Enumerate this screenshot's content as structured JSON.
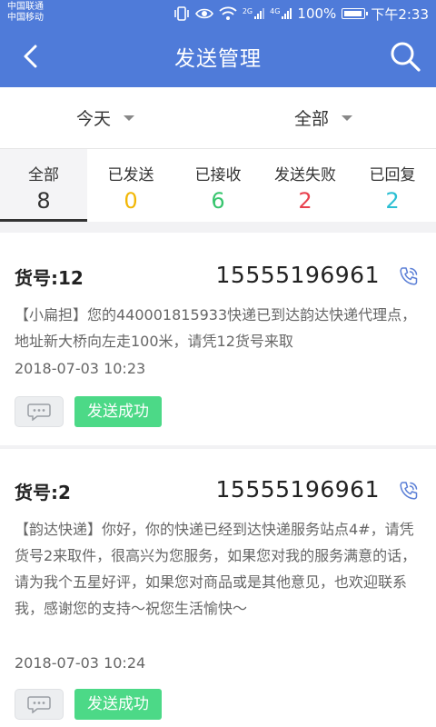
{
  "status_bar": {
    "carrier1": "中国联通",
    "carrier2": "中国移动",
    "net_label_1": "2G",
    "net_label_2": "4G",
    "battery": "100%",
    "battery_level": 1.0,
    "time": "下午2:33"
  },
  "header": {
    "title": "发送管理",
    "back_icon": "chevron-left-icon",
    "search_icon": "search-icon",
    "bg_color": "#4f7bd9"
  },
  "filters": {
    "date": "今天",
    "status": "全部"
  },
  "tabs": [
    {
      "label": "全部",
      "count": "8",
      "color": "#333333",
      "active": true
    },
    {
      "label": "已发送",
      "count": "0",
      "color": "#f2b705",
      "active": false
    },
    {
      "label": "已接收",
      "count": "6",
      "color": "#37c56e",
      "active": false
    },
    {
      "label": "发送失败",
      "count": "2",
      "color": "#e8414e",
      "active": false
    },
    {
      "label": "已回复",
      "count": "2",
      "color": "#2bbfd3",
      "active": false
    }
  ],
  "messages": [
    {
      "goods_no": "货号:12",
      "phone": "15555196961",
      "content": "【小扁担】您的440001815933快递已到达韵达快递代理点，地址新大桥向左走100米，请凭12货号来取",
      "time": "2018-07-03 10:23",
      "status": "发送成功"
    },
    {
      "goods_no": "货号:2",
      "phone": "15555196961",
      "content": "【韵达快递】你好，你的快递已经到达快递服务站点4#，请凭货号2来取件，很高兴为您服务，如果您对我的服务满意的话，请为我个五星好评，如果您对商品或是其他意见，也欢迎联系我，感谢您的支持～祝您生活愉快～",
      "time": "2018-07-03 10:24",
      "status": "发送成功"
    }
  ],
  "colors": {
    "success_badge": "#4cd987",
    "call_icon": "#5b7fd6"
  }
}
